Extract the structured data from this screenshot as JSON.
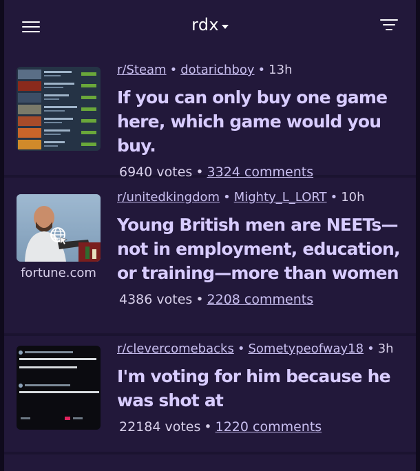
{
  "header": {
    "app_name": "rdx"
  },
  "posts": [
    {
      "subreddit": "r/Steam",
      "author": "dotarichboy",
      "age": "13h",
      "title": "If you can only buy one game here, which game would you buy.",
      "votes": "6940 votes",
      "comments": "3324 comments"
    },
    {
      "subreddit": "r/unitedkingdom",
      "author": "Mighty_L_LORT",
      "age": "10h",
      "title": "Young British men are NEETs—not in employment, education, or training—more than women",
      "votes": "4386 votes",
      "comments": "2208 comments",
      "source": "fortune.com"
    },
    {
      "subreddit": "r/clevercomebacks",
      "author": "Sometypeofway18",
      "age": "3h",
      "title": "I'm voting for him because he was shot at",
      "votes": "22184 votes",
      "comments": "1220 comments"
    }
  ],
  "separator": "•",
  "colors": {
    "background": "#1b1330",
    "card": "#22183a",
    "title": "#d8ccff",
    "link": "#c9bff0"
  },
  "icons": [
    "menu-icon",
    "dropdown-caret-icon",
    "filter-icon",
    "globe-link-icon"
  ]
}
